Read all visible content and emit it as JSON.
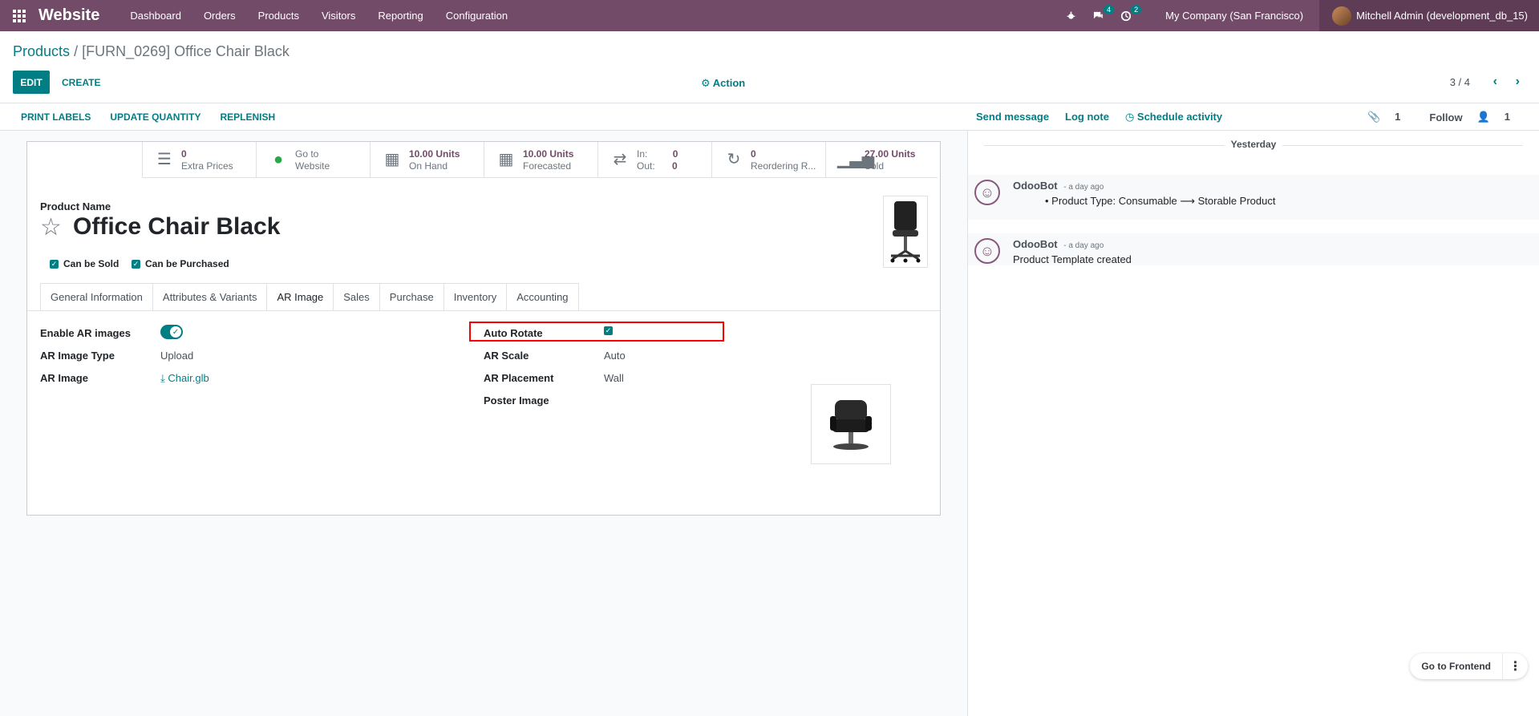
{
  "navbar": {
    "brand": "Website",
    "menu": [
      "Dashboard",
      "Orders",
      "Products",
      "Visitors",
      "Reporting",
      "Configuration"
    ],
    "messages_count": "4",
    "activities_count": "2",
    "company": "My Company (San Francisco)",
    "user": "Mitchell Admin (development_db_15)"
  },
  "control": {
    "breadcrumb_root": "Products",
    "breadcrumb_sep": "/",
    "breadcrumb_current": "[FURN_0269] Office Chair Black",
    "edit": "EDIT",
    "create": "CREATE",
    "action": "Action",
    "pager": "3 / 4"
  },
  "statusbar": {
    "buttons": [
      "PRINT LABELS",
      "UPDATE QUANTITY",
      "REPLENISH"
    ]
  },
  "smart_buttons": [
    {
      "value": "0",
      "label": "Extra Prices",
      "icon": "list-icon"
    },
    {
      "value": "Go to",
      "label": "Website",
      "icon": "globe-icon"
    },
    {
      "value": "10.00 Units",
      "label": "On Hand",
      "icon": "cubes-icon"
    },
    {
      "value": "10.00 Units",
      "label": "Forecasted",
      "icon": "cubes-icon"
    },
    {
      "value": "In:",
      "value2": "0",
      "label": "Out:",
      "label2": "0",
      "icon": "exchange-icon"
    },
    {
      "value": "0",
      "label": "Reordering R...",
      "icon": "refresh-icon"
    },
    {
      "value": "27.00 Units",
      "label": "Sold",
      "icon": "signal-icon"
    }
  ],
  "form": {
    "product_name_label": "Product Name",
    "product_name": "Office Chair Black",
    "can_be_sold": "Can be Sold",
    "can_be_purchased": "Can be Purchased",
    "tabs": [
      "General Information",
      "Attributes & Variants",
      "AR Image",
      "Sales",
      "Purchase",
      "Inventory",
      "Accounting"
    ],
    "enable_ar_label": "Enable AR images",
    "ar_image_type_label": "AR Image Type",
    "ar_image_type": "Upload",
    "ar_image_label": "AR Image",
    "ar_image": "Chair.glb",
    "auto_rotate_label": "Auto Rotate",
    "ar_scale_label": "AR Scale",
    "ar_scale": "Auto",
    "ar_placement_label": "AR Placement",
    "ar_placement": "Wall",
    "poster_label": "Poster Image"
  },
  "chatter": {
    "send_message": "Send message",
    "log_note": "Log note",
    "schedule_activity": "Schedule activity",
    "attachments": "1",
    "follow": "Follow",
    "followers": "1",
    "date_divider": "Yesterday",
    "messages": [
      {
        "author": "OdooBot",
        "time": "- a day ago",
        "body_old": "Product Type: Consumable",
        "arrow": "⟶",
        "body_new": "Storable Product"
      },
      {
        "author": "OdooBot",
        "time": "- a day ago",
        "body": "Product Template created"
      }
    ]
  },
  "floating": {
    "go_to_frontend": "Go to Frontend"
  },
  "colors": {
    "brand": "#714B67",
    "accent": "#017e84",
    "highlight": "#ff0000"
  }
}
